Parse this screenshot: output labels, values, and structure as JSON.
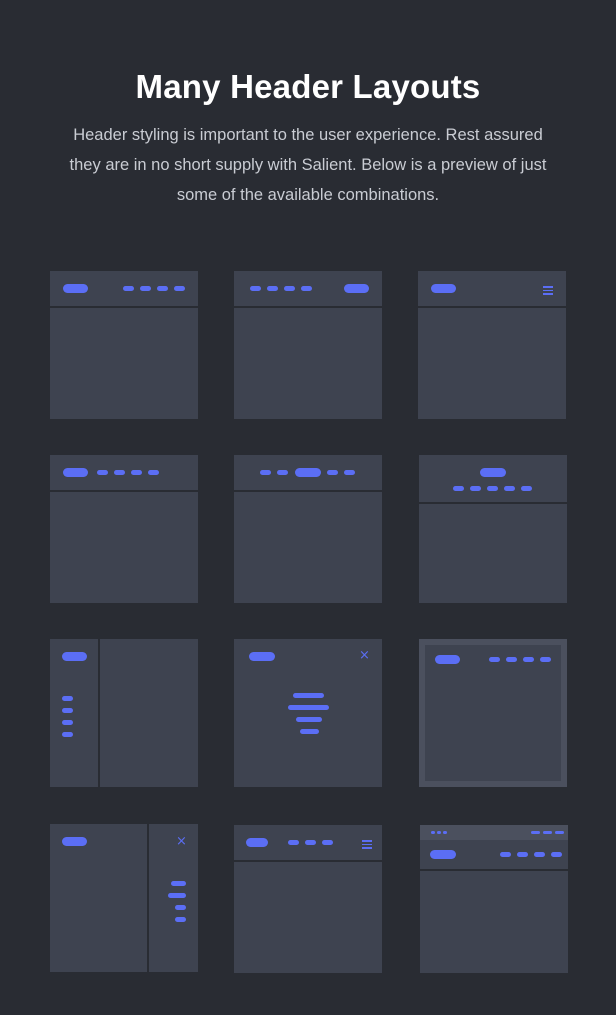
{
  "section": {
    "title": "Many Header Layouts",
    "subtitle": "Header styling is important to the user experience. Rest assured they are in no short supply with Salient. Below is a preview of just some of the available combinations."
  },
  "layouts": [
    {
      "name": "left-logo-right-nav"
    },
    {
      "name": "left-nav-right-logo"
    },
    {
      "name": "left-logo-hamburger"
    },
    {
      "name": "left-logo-left-nav"
    },
    {
      "name": "centered-logo-split-nav"
    },
    {
      "name": "centered-logo-nav-below"
    },
    {
      "name": "left-sidebar-header"
    },
    {
      "name": "fullscreen-menu-overlay",
      "close_icon": "×"
    },
    {
      "name": "boxed-header"
    },
    {
      "name": "off-canvas-right-menu",
      "close_icon": "×"
    },
    {
      "name": "logo-nav-hamburger"
    },
    {
      "name": "secondary-top-bar"
    }
  ],
  "colors": {
    "background": "#292c33",
    "card": "#3e4350",
    "accent": "#5b6ef5"
  }
}
